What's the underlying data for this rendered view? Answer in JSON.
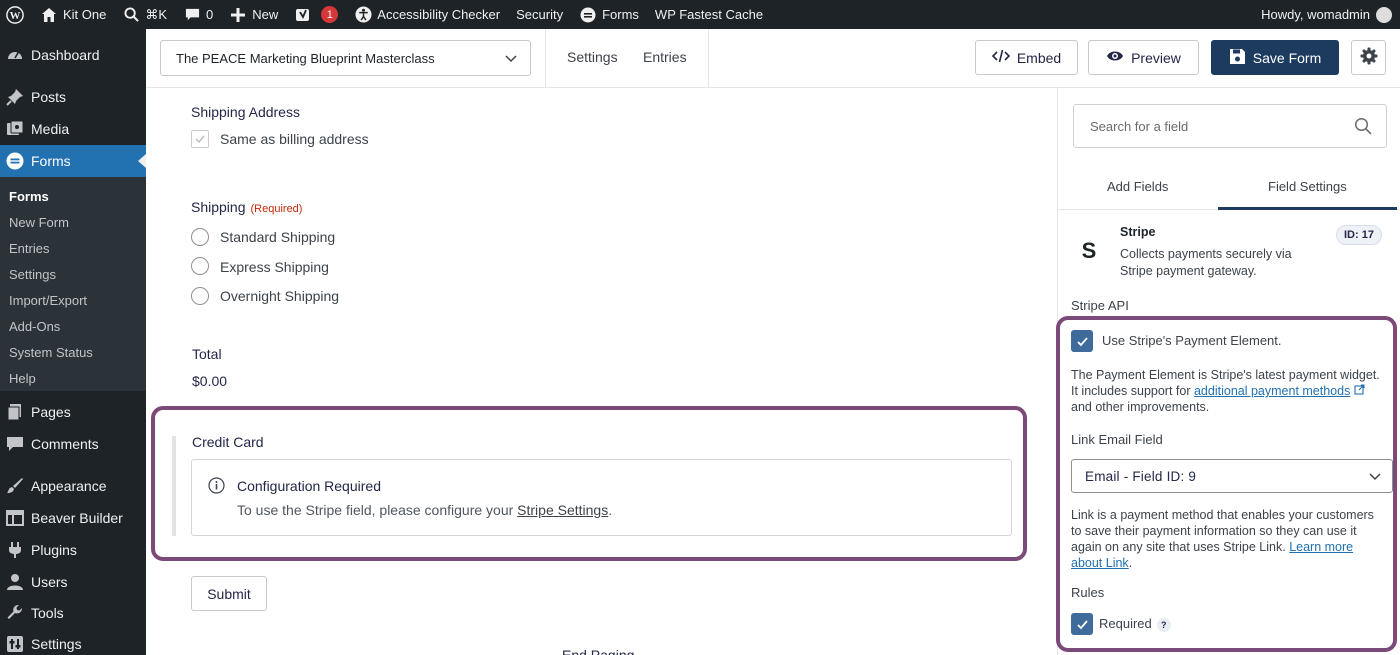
{
  "adminbar": {
    "site_name": "Kit One",
    "shortcut": "⌘K",
    "comments_count": "0",
    "new_label": "New",
    "yoast_badge": "1",
    "accessibility_label": "Accessibility Checker",
    "security_label": "Security",
    "forms_label": "Forms",
    "cache_label": "WP Fastest Cache",
    "howdy": "Howdy, womadmin"
  },
  "sidebar": {
    "items": [
      {
        "label": "Dashboard",
        "icon": "dashboard-icon"
      },
      {
        "label": "Posts",
        "icon": "pin-icon"
      },
      {
        "label": "Media",
        "icon": "media-icon"
      },
      {
        "label": "Forms",
        "icon": "forms-icon"
      },
      {
        "label": "Pages",
        "icon": "pages-icon"
      },
      {
        "label": "Comments",
        "icon": "comment-icon"
      },
      {
        "label": "Appearance",
        "icon": "brush-icon"
      },
      {
        "label": "Beaver Builder",
        "icon": "grid-icon"
      },
      {
        "label": "Plugins",
        "icon": "plug-icon"
      },
      {
        "label": "Users",
        "icon": "user-icon"
      },
      {
        "label": "Tools",
        "icon": "wrench-icon"
      },
      {
        "label": "Settings",
        "icon": "settings-icon"
      }
    ],
    "submenu": [
      "Forms",
      "New Form",
      "Entries",
      "Settings",
      "Import/Export",
      "Add-Ons",
      "System Status",
      "Help"
    ]
  },
  "toolbar": {
    "form_name": "The PEACE Marketing Blueprint Masterclass",
    "settings_label": "Settings",
    "entries_label": "Entries",
    "embed_label": "Embed",
    "preview_label": "Preview",
    "save_label": "Save Form"
  },
  "form": {
    "shipping_address_label": "Shipping Address",
    "same_as_billing": "Same as billing address",
    "shipping_label": "Shipping",
    "required_text": "(Required)",
    "shipping_options": [
      "Standard Shipping",
      "Express Shipping",
      "Overnight Shipping"
    ],
    "total_label": "Total",
    "total_value": "$0.00",
    "credit_card_label": "Credit Card",
    "notice_title": "Configuration Required",
    "notice_text_before": "To use the Stripe field, please configure your ",
    "notice_link": "Stripe Settings",
    "notice_text_after": ".",
    "submit_label": "Submit",
    "end_paging_label": "End Paging"
  },
  "panel": {
    "search_placeholder": "Search for a field",
    "tab_add_fields": "Add Fields",
    "tab_field_settings": "Field Settings",
    "field_title": "Stripe",
    "field_desc_line1": "Collects payments securely via",
    "field_desc_line2": "Stripe payment gateway.",
    "field_id": "ID: 17",
    "stripe_api_label": "Stripe API",
    "use_payment_element": "Use Stripe's Payment Element.",
    "pe_desc_line1": "The Payment Element is Stripe's latest payment widget.",
    "pe_desc_line2_pre": "It includes support for ",
    "pe_desc_link": "additional payment methods",
    "pe_desc_line3": "and other improvements.",
    "link_email_label": "Link Email Field",
    "link_email_value": "Email - Field ID: 9",
    "link_desc_line1": "Link is a payment method that enables your customers",
    "link_desc_line2": "to save their payment information so they can use it",
    "link_desc_line3_pre": "again on any site that uses Stripe Link. ",
    "link_desc_link1": "Learn more",
    "link_desc_link2": "about Link",
    "link_desc_line4_post": ".",
    "rules_label": "Rules",
    "required_label": "Required",
    "help_mark": "?"
  },
  "colors": {
    "admin_bg": "#1d2327",
    "active_menu": "#2271b1",
    "primary_button": "#1d3a5f",
    "highlight_box": "#7c4a79",
    "required_red": "#c02b0a",
    "checkbox_blue": "#3e6b9c"
  }
}
